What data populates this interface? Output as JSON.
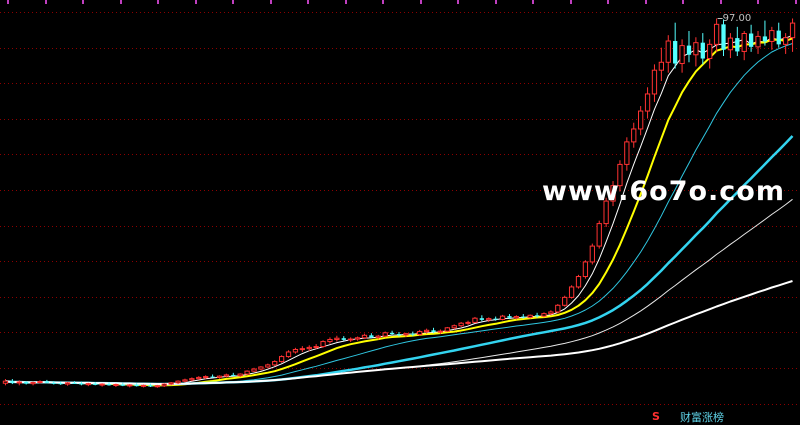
{
  "chart_data": {
    "type": "line",
    "candles": [
      [
        9.5,
        10.5,
        9.0,
        10.0
      ],
      [
        10.0,
        10.5,
        9.3,
        9.6
      ],
      [
        9.6,
        10.2,
        9.0,
        9.8
      ],
      [
        9.8,
        10.0,
        9.2,
        9.4
      ],
      [
        9.4,
        9.9,
        9.0,
        9.7
      ],
      [
        9.7,
        10.2,
        9.4,
        9.9
      ],
      [
        9.9,
        10.3,
        9.5,
        9.6
      ],
      [
        9.6,
        10.0,
        9.2,
        9.5
      ],
      [
        9.5,
        9.9,
        9.1,
        9.3
      ],
      [
        9.3,
        9.8,
        8.9,
        9.6
      ],
      [
        9.6,
        10.0,
        9.4,
        9.5
      ],
      [
        9.5,
        9.9,
        9.0,
        9.2
      ],
      [
        9.2,
        9.6,
        8.8,
        9.4
      ],
      [
        9.4,
        9.8,
        9.0,
        9.1
      ],
      [
        9.1,
        9.5,
        8.7,
        9.3
      ],
      [
        9.3,
        9.7,
        8.9,
        9.0
      ],
      [
        9.0,
        9.4,
        8.6,
        9.2
      ],
      [
        9.2,
        9.6,
        8.8,
        8.9
      ],
      [
        8.9,
        9.3,
        8.5,
        9.1
      ],
      [
        9.1,
        9.5,
        8.7,
        8.8
      ],
      [
        8.8,
        9.2,
        8.5,
        9.0
      ],
      [
        9.0,
        9.4,
        8.6,
        8.7
      ],
      [
        8.7,
        9.1,
        8.4,
        8.9
      ],
      [
        8.9,
        9.5,
        8.6,
        9.3
      ],
      [
        9.3,
        9.8,
        9.0,
        9.6
      ],
      [
        9.6,
        10.2,
        9.3,
        10.0
      ],
      [
        10.0,
        10.6,
        9.7,
        10.3
      ],
      [
        10.3,
        10.9,
        10.0,
        10.6
      ],
      [
        10.6,
        11.2,
        10.3,
        10.9
      ],
      [
        10.9,
        11.4,
        10.5,
        11.1
      ],
      [
        11.1,
        11.6,
        10.8,
        10.9
      ],
      [
        10.9,
        11.4,
        10.6,
        11.2
      ],
      [
        11.2,
        11.8,
        10.9,
        11.5
      ],
      [
        11.5,
        12.0,
        11.2,
        11.3
      ],
      [
        11.3,
        11.9,
        11.0,
        11.7
      ],
      [
        11.7,
        12.6,
        11.5,
        12.4
      ],
      [
        12.4,
        13.2,
        12.2,
        12.9
      ],
      [
        12.9,
        13.6,
        12.6,
        13.4
      ],
      [
        13.4,
        14.2,
        13.1,
        13.9
      ],
      [
        13.9,
        15.0,
        13.6,
        14.7
      ],
      [
        14.7,
        16.2,
        14.4,
        15.9
      ],
      [
        15.9,
        17.4,
        15.6,
        17.0
      ],
      [
        17.0,
        18.0,
        16.6,
        17.6
      ],
      [
        17.6,
        18.4,
        17.0,
        17.8
      ],
      [
        17.8,
        18.6,
        17.2,
        18.1
      ],
      [
        18.1,
        18.9,
        17.7,
        18.3
      ],
      [
        18.3,
        19.8,
        18.0,
        19.5
      ],
      [
        19.5,
        20.5,
        19.0,
        20.0
      ],
      [
        20.0,
        20.9,
        19.5,
        20.3
      ],
      [
        20.3,
        20.8,
        19.7,
        19.9
      ],
      [
        19.9,
        20.5,
        19.4,
        20.1
      ],
      [
        20.1,
        20.7,
        19.7,
        20.4
      ],
      [
        20.4,
        21.4,
        20.1,
        21.0
      ],
      [
        21.0,
        21.5,
        20.3,
        20.5
      ],
      [
        20.5,
        21.1,
        20.0,
        20.8
      ],
      [
        20.8,
        21.9,
        20.5,
        21.6
      ],
      [
        21.6,
        22.1,
        21.0,
        21.3
      ],
      [
        21.3,
        21.8,
        20.7,
        21.1
      ],
      [
        21.1,
        21.6,
        20.6,
        21.4
      ],
      [
        21.4,
        21.9,
        20.8,
        21.2
      ],
      [
        21.2,
        22.3,
        20.9,
        21.9
      ],
      [
        21.9,
        22.6,
        21.4,
        22.2
      ],
      [
        22.2,
        22.8,
        21.5,
        21.8
      ],
      [
        21.8,
        22.4,
        21.3,
        22.0
      ],
      [
        22.0,
        23.0,
        21.8,
        22.8
      ],
      [
        22.8,
        23.6,
        22.4,
        23.3
      ],
      [
        23.3,
        24.2,
        23.0,
        23.9
      ],
      [
        23.9,
        24.5,
        23.5,
        24.1
      ],
      [
        24.1,
        25.4,
        23.9,
        25.1
      ],
      [
        25.1,
        25.8,
        24.4,
        24.7
      ],
      [
        24.7,
        25.3,
        24.2,
        25.0
      ],
      [
        25.0,
        25.5,
        24.5,
        24.8
      ],
      [
        24.8,
        25.9,
        24.6,
        25.6
      ],
      [
        25.6,
        26.1,
        24.9,
        25.2
      ],
      [
        25.2,
        25.8,
        24.8,
        25.5
      ],
      [
        25.5,
        26.1,
        25.0,
        25.3
      ],
      [
        25.3,
        26.0,
        25.0,
        25.8
      ],
      [
        25.8,
        26.4,
        25.2,
        25.6
      ],
      [
        25.6,
        26.5,
        25.3,
        26.2
      ],
      [
        26.2,
        27.0,
        25.8,
        26.6
      ],
      [
        26.6,
        28.5,
        26.3,
        28.2
      ],
      [
        28.2,
        30.5,
        27.9,
        30.1
      ],
      [
        30.1,
        33.0,
        29.8,
        32.6
      ],
      [
        32.6,
        35.5,
        32.2,
        35.1
      ],
      [
        35.1,
        39.0,
        34.6,
        38.6
      ],
      [
        38.6,
        43.0,
        38.0,
        42.4
      ],
      [
        42.4,
        48.5,
        41.8,
        47.8
      ],
      [
        47.8,
        54.0,
        47.0,
        53.2
      ],
      [
        53.2,
        58.0,
        52.0,
        56.9
      ],
      [
        56.9,
        63.0,
        55.5,
        62.0
      ],
      [
        62.0,
        68.5,
        60.5,
        67.4
      ],
      [
        67.4,
        72.0,
        66.0,
        70.5
      ],
      [
        70.5,
        76.0,
        69.0,
        74.8
      ],
      [
        74.8,
        80.5,
        73.0,
        78.9
      ],
      [
        78.9,
        86.0,
        77.0,
        84.6
      ],
      [
        84.6,
        90.0,
        82.0,
        86.5
      ],
      [
        86.5,
        93.0,
        84.0,
        91.6
      ],
      [
        91.6,
        96.0,
        85.0,
        86.2
      ],
      [
        86.2,
        92.0,
        84.0,
        90.5
      ],
      [
        90.5,
        94.0,
        86.5,
        88.3
      ],
      [
        88.3,
        92.5,
        85.5,
        91.2
      ],
      [
        91.2,
        93.5,
        86.0,
        87.4
      ],
      [
        87.4,
        92.0,
        85.0,
        90.8
      ],
      [
        90.8,
        97.0,
        89.0,
        95.6
      ],
      [
        95.6,
        96.8,
        88.0,
        89.5
      ],
      [
        89.5,
        93.5,
        87.5,
        92.3
      ],
      [
        92.3,
        95.0,
        88.0,
        89.1
      ],
      [
        89.1,
        94.0,
        87.0,
        93.4
      ],
      [
        93.4,
        95.5,
        89.0,
        90.2
      ],
      [
        90.2,
        94.0,
        88.5,
        92.7
      ],
      [
        92.7,
        96.5,
        90.5,
        91.5
      ],
      [
        91.5,
        95.0,
        89.5,
        94.1
      ],
      [
        94.1,
        96.0,
        90.0,
        90.8
      ],
      [
        90.8,
        93.5,
        88.5,
        92.4
      ],
      [
        92.4,
        97.0,
        89.0,
        95.9
      ]
    ],
    "ma_periods": [
      5,
      10,
      20,
      40,
      60,
      120
    ],
    "ma_colors": [
      "#ffffff",
      "#ffff00",
      "#2fc6e0",
      "#33d4f0",
      "#e8e8e8",
      "#ffffff"
    ],
    "ma_widths": [
      1,
      2,
      1,
      2.5,
      1,
      2
    ],
    "up_color": "#ff3232",
    "down_color": "#54ffff",
    "grid_color": "#8c0000",
    "y_max": 97.0,
    "y_max_label": "97.00",
    "y_range": [
      5,
      100
    ]
  },
  "watermark": "www.6o7o.com",
  "markers": {
    "s_label": "S",
    "text_label": "财富涨榜"
  }
}
